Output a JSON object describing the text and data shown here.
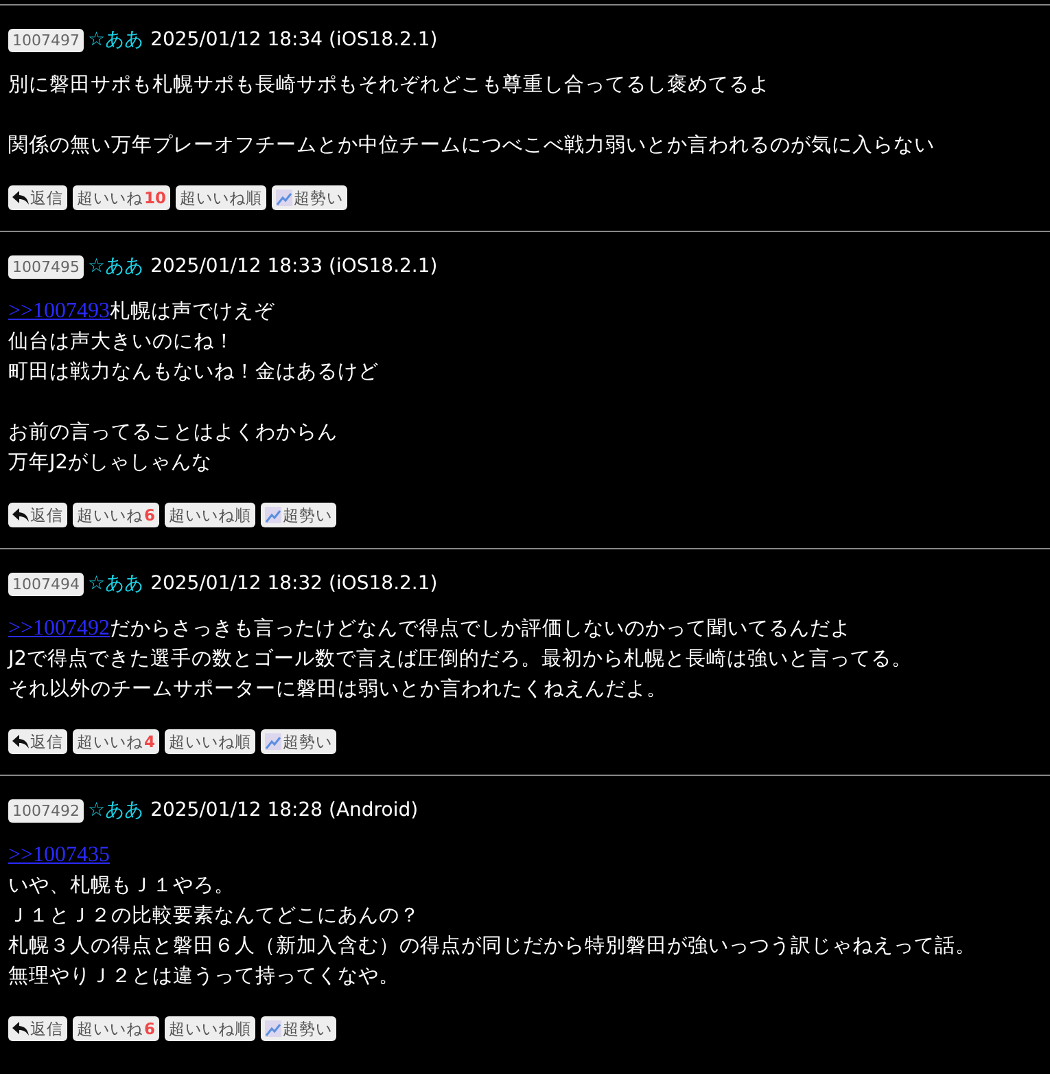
{
  "posts": [
    {
      "number": "1007497",
      "name": "☆ああ",
      "datetime": "2025/01/12 18:34 (iOS18.2.1)",
      "paragraphs": [
        {
          "lines": [
            {
              "text": "別に磐田サポも札幌サポも長崎サポもそれぞれどこも尊重し合ってるし褒めてるよ"
            }
          ]
        },
        {
          "lines": [
            {
              "text": "関係の無い万年プレーオフチームとか中位チームにつべこべ戦力弱いとか言われるのが気に入らない"
            }
          ]
        }
      ],
      "buttons": {
        "reply": "返信",
        "like": "超いいね",
        "like_count": "10",
        "sort": "超いいね順",
        "trend": "超勢い"
      }
    },
    {
      "number": "1007495",
      "name": "☆ああ",
      "datetime": "2025/01/12 18:33 (iOS18.2.1)",
      "paragraphs": [
        {
          "lines": [
            {
              "link": ">>1007493",
              "text": "札幌は声でけえぞ"
            },
            {
              "text": "仙台は声大きいのにね！"
            },
            {
              "text": "町田は戦力なんもないね！金はあるけど"
            }
          ]
        },
        {
          "lines": [
            {
              "text": "お前の言ってることはよくわからん"
            },
            {
              "text": "万年J2がしゃしゃんな"
            }
          ]
        }
      ],
      "buttons": {
        "reply": "返信",
        "like": "超いいね",
        "like_count": "6",
        "sort": "超いいね順",
        "trend": "超勢い"
      }
    },
    {
      "number": "1007494",
      "name": "☆ああ",
      "datetime": "2025/01/12 18:32 (iOS18.2.1)",
      "paragraphs": [
        {
          "lines": [
            {
              "link": ">>1007492",
              "text": "だからさっきも言ったけどなんで得点でしか評価しないのかって聞いてるんだよ"
            },
            {
              "text": "J2で得点できた選手の数とゴール数で言えば圧倒的だろ。最初から札幌と長崎は強いと言ってる。"
            },
            {
              "text": "それ以外のチームサポーターに磐田は弱いとか言われたくねえんだよ。"
            }
          ]
        }
      ],
      "buttons": {
        "reply": "返信",
        "like": "超いいね",
        "like_count": "4",
        "sort": "超いいね順",
        "trend": "超勢い"
      }
    },
    {
      "number": "1007492",
      "name": "☆ああ",
      "datetime": "2025/01/12 18:28 (Android)",
      "paragraphs": [
        {
          "lines": [
            {
              "link": ">>1007435"
            },
            {
              "text": "いや、札幌もＪ１やろ。"
            },
            {
              "text": "Ｊ１とＪ２の比較要素なんてどこにあんの？"
            },
            {
              "text": "札幌３人の得点と磐田６人（新加入含む）の得点が同じだから特別磐田が強いっつう訳じゃねえって話。"
            },
            {
              "text": "無理やりＪ２とは違うって持ってくなや。"
            }
          ]
        }
      ],
      "buttons": {
        "reply": "返信",
        "like": "超いいね",
        "like_count": "6",
        "sort": "超いいね順",
        "trend": "超勢い"
      }
    }
  ]
}
